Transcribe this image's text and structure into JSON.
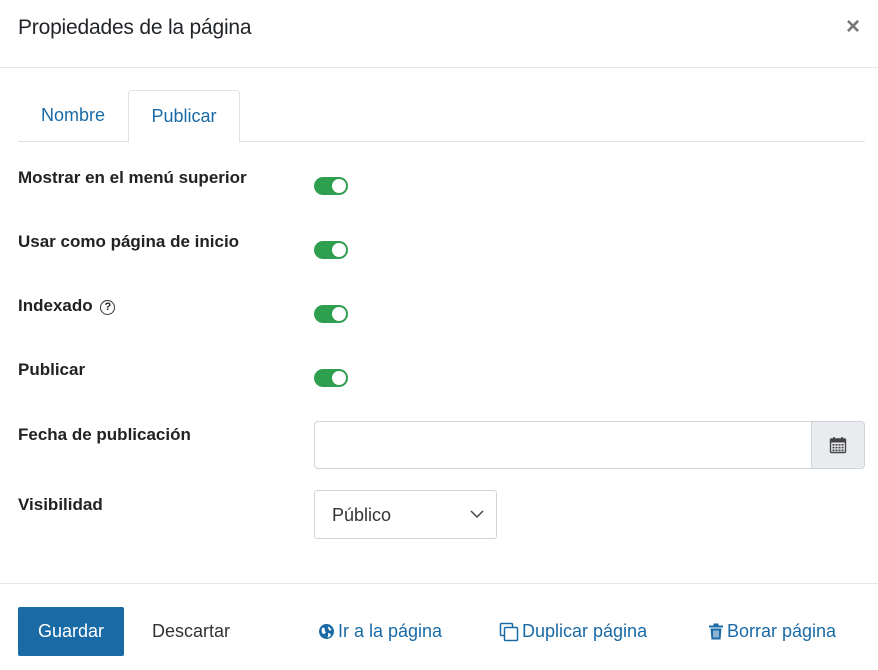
{
  "header": {
    "title": "Propiedades de la página",
    "close_label": "×"
  },
  "tabs": [
    {
      "label": "Nombre",
      "active": false
    },
    {
      "label": "Publicar",
      "active": true
    }
  ],
  "form": {
    "show_top_menu": {
      "label": "Mostrar en el menú superior",
      "checked": true
    },
    "use_as_home": {
      "label": "Usar como página de inicio",
      "checked": true
    },
    "indexed": {
      "label": "Indexado",
      "help_icon": "question-circle-icon",
      "checked": true
    },
    "publish": {
      "label": "Publicar",
      "checked": true
    },
    "publish_date": {
      "label": "Fecha de publicación",
      "value": "",
      "calendar_icon": "calendar-icon"
    },
    "visibility": {
      "label": "Visibilidad",
      "selected": "Público"
    }
  },
  "footer": {
    "save_label": "Guardar",
    "discard_label": "Descartar",
    "goto_label": "Ir a la página",
    "duplicate_label": "Duplicar página",
    "delete_label": "Borrar página"
  },
  "colors": {
    "accent": "#1a6aa6",
    "toggle_on": "#2e9e4f"
  }
}
